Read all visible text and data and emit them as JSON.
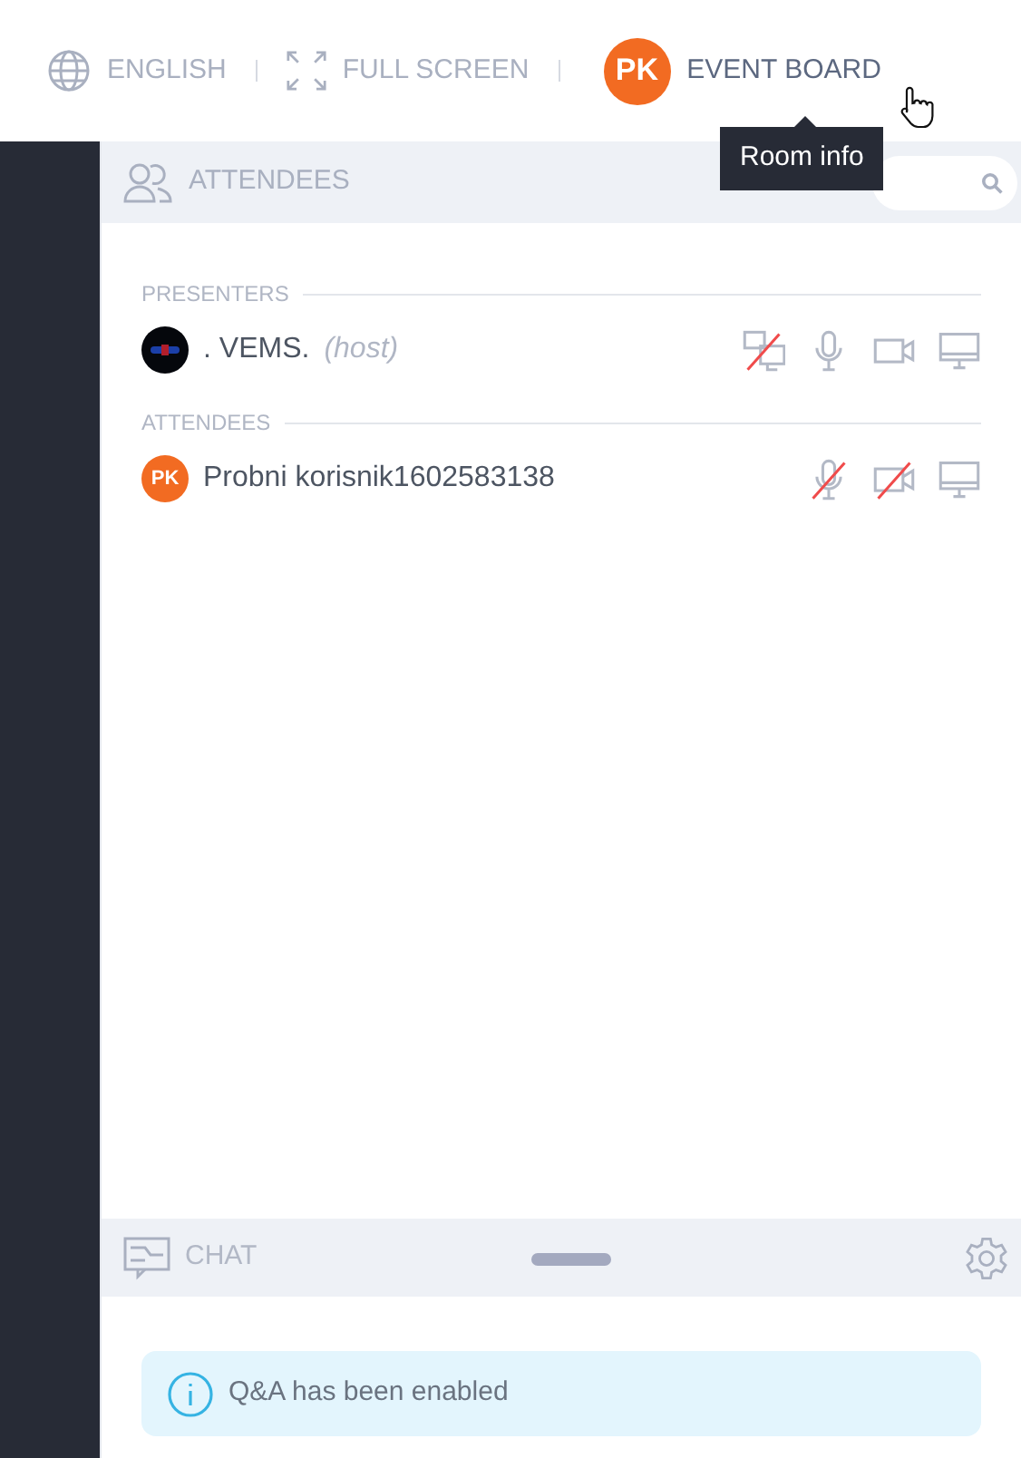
{
  "top_bar": {
    "items": [
      {
        "kind": "language",
        "label": "ENGLISH"
      },
      {
        "kind": "fullscreen",
        "label": "FULL SCREEN"
      },
      {
        "kind": "room",
        "avatar": "PK",
        "label": "EVENT BOARD"
      }
    ]
  },
  "tooltip": {
    "text": "Room info"
  },
  "attendees_panel": {
    "title": "ATTENDEES",
    "groups": [
      {
        "title": "PRESENTERS",
        "members": [
          {
            "kind": "logo",
            "name": ". VEMS.",
            "role": "(host)",
            "controls": [
              {
                "kind": "presenter",
                "off": true
              },
              {
                "kind": "mic",
                "off": false
              },
              {
                "kind": "camera",
                "off": false
              },
              {
                "kind": "screen",
                "off": false
              }
            ]
          }
        ]
      },
      {
        "title": "ATTENDEES",
        "members": [
          {
            "kind": "initials",
            "avatar": "PK",
            "name": "Probni korisnik1602583138",
            "controls": [
              {
                "kind": "mic",
                "off": true
              },
              {
                "kind": "camera",
                "off": true
              },
              {
                "kind": "screen",
                "off": false
              }
            ]
          }
        ]
      }
    ]
  },
  "chat_panel": {
    "title": "CHAT",
    "notice": "Q&A has been enabled"
  }
}
